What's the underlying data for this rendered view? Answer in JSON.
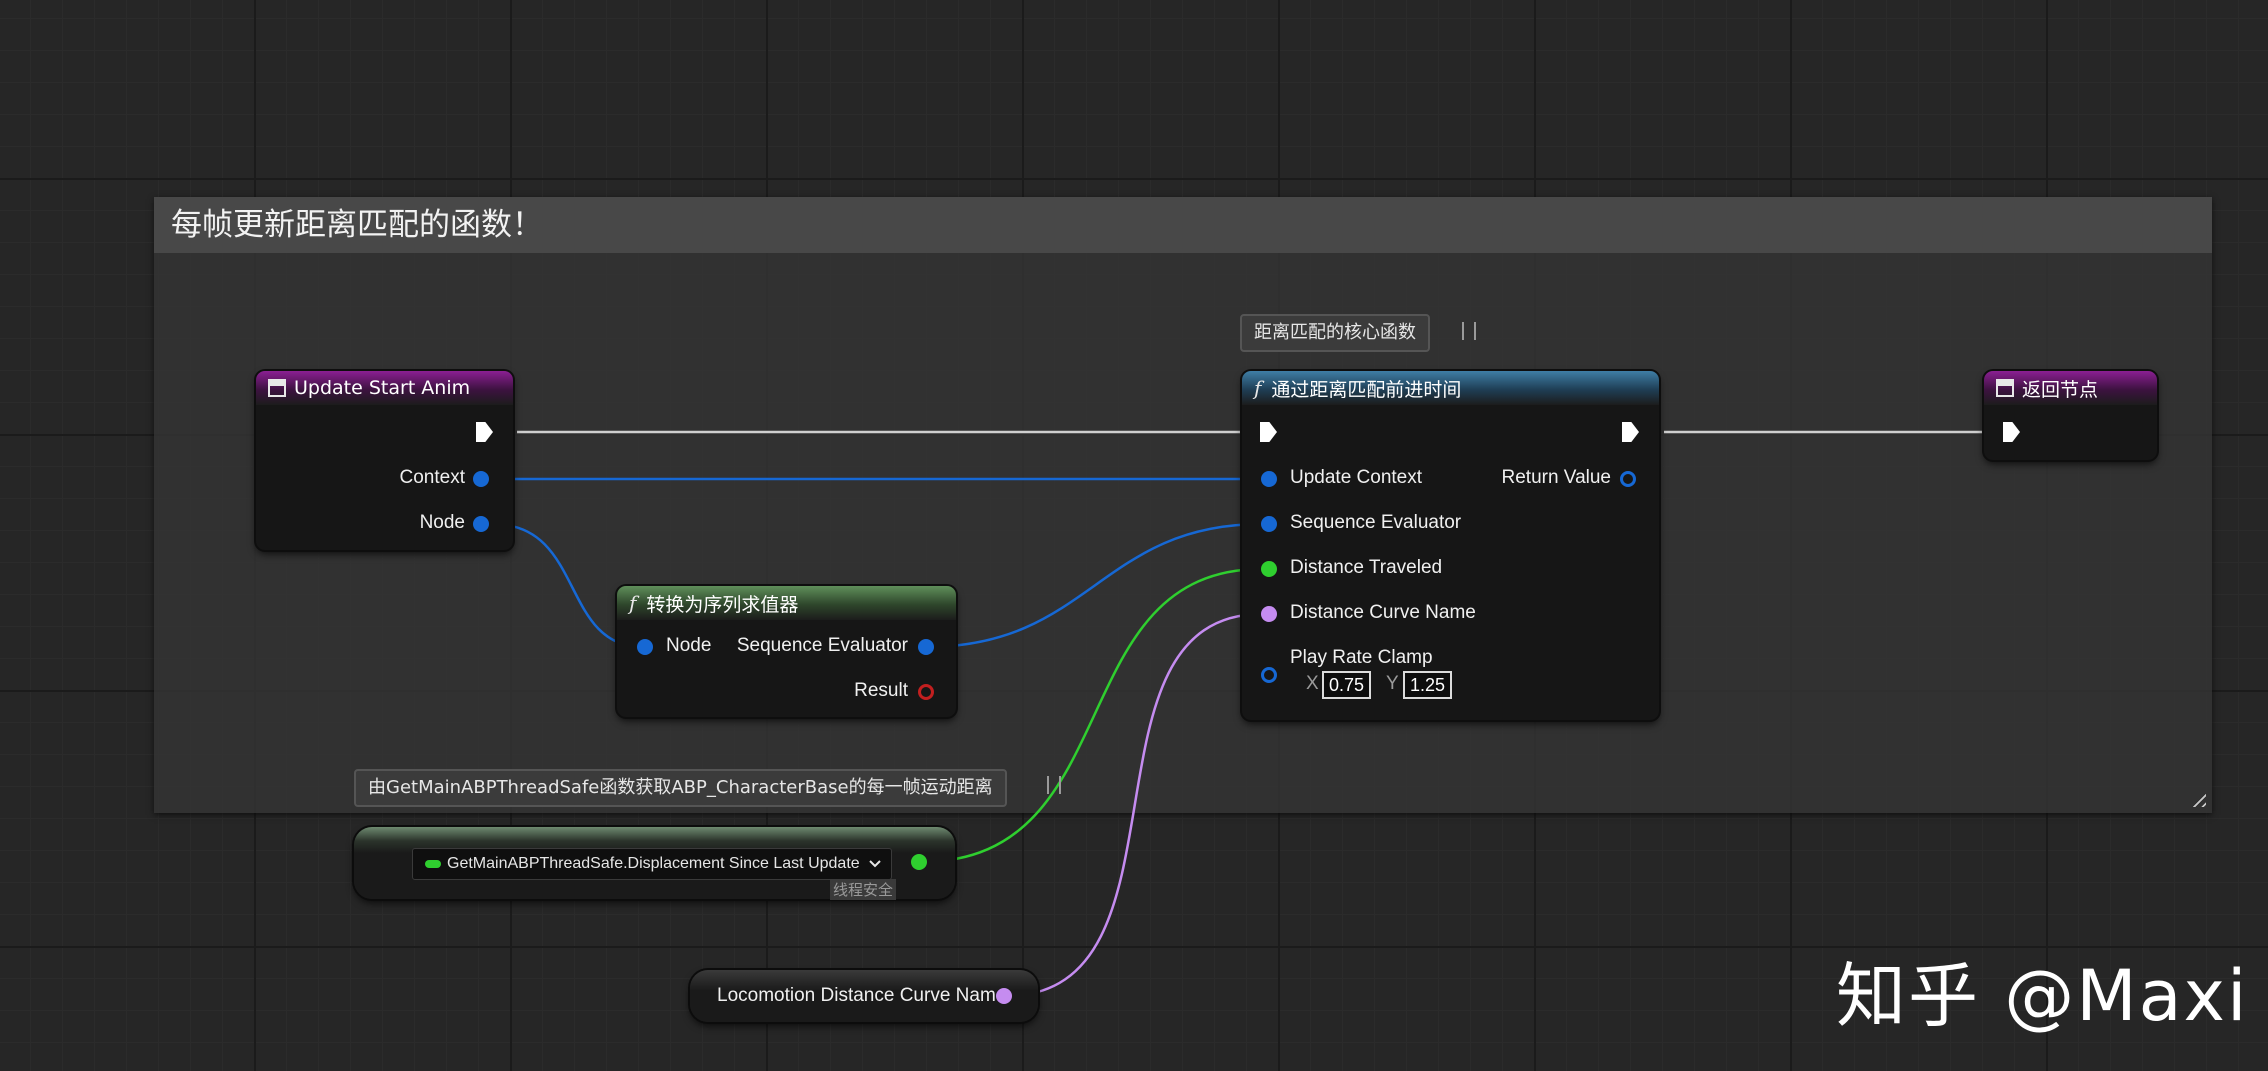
{
  "colors": {
    "event_header": "#8b1f93",
    "function_header": "#3f7ea6",
    "pure_function_header": "#5f8f5a",
    "struct_pin": "#1668d4",
    "float_pin": "#2fcf2f",
    "name_pin": "#c58cf0",
    "bool_pin": "#c21f1f",
    "exec_wire": "#cfcfcf"
  },
  "comment": {
    "title": "每帧更新距离匹配的函数！"
  },
  "entry_node": {
    "title": "Update Start Anim",
    "icon": "function-entry-icon",
    "pins": {
      "context": "Context",
      "node": "Node"
    }
  },
  "convert_node": {
    "icon": "function-f-icon",
    "title": "转换为序列求值器",
    "pins": {
      "node": "Node",
      "sequence_evaluator": "Sequence Evaluator",
      "result": "Result"
    }
  },
  "main_node": {
    "bubble": "距离匹配的核心函数",
    "icon": "function-f-icon",
    "title": "通过距离匹配前进时间",
    "pins": {
      "update_context": "Update Context",
      "sequence_evaluator": "Sequence Evaluator",
      "distance_traveled": "Distance Traveled",
      "distance_curve_name": "Distance Curve Name",
      "play_rate_clamp": "Play Rate Clamp",
      "return_value": "Return Value"
    },
    "play_rate_clamp": {
      "x_label": "X",
      "x_value": "0.75",
      "y_label": "Y",
      "y_value": "1.25"
    }
  },
  "return_node": {
    "title": "返回节点",
    "icon": "function-return-icon"
  },
  "property_node": {
    "bubble": "由GetMainABPThreadSafe函数获取ABP_CharacterBase的每一帧运动距离",
    "binding": "GetMainABPThreadSafe.Displacement Since Last Update",
    "dropdown_icon": "chevron-down-icon",
    "thread_safe_label": "线程安全"
  },
  "curve_name_node": {
    "label": "Locomotion Distance Curve Name"
  },
  "watermark": {
    "text": "知乎 @Maxi"
  }
}
